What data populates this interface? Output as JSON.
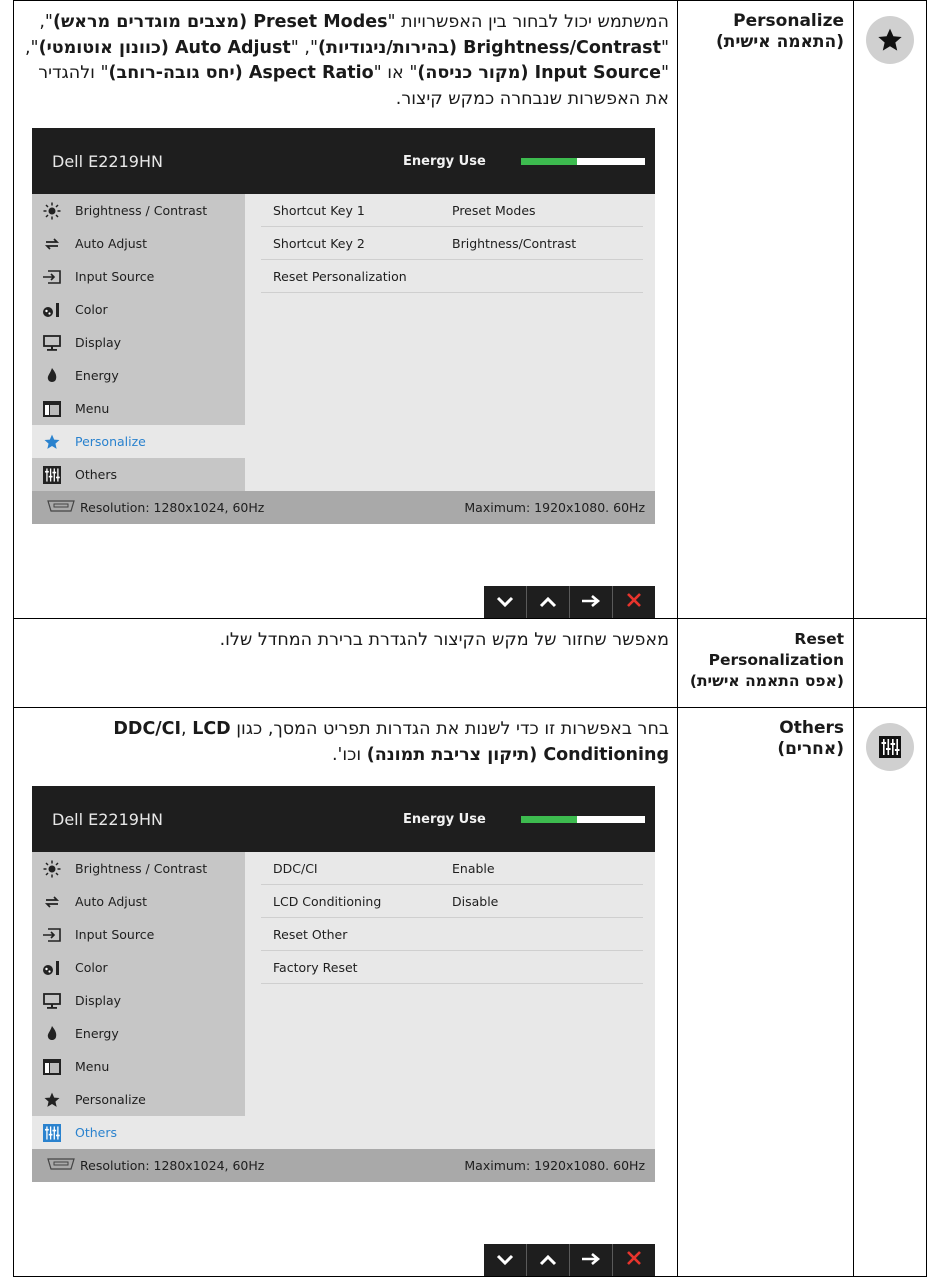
{
  "rows": [
    {
      "name_line1": "Personalize",
      "name_line2": "(התאמה אישית)",
      "icon": "star-icon",
      "desc_html_parts": {
        "p1": "המשתמש יכול לבחור בין האפשרויות \"",
        "b1": "Preset Modes (מצבים מוגדרים מראש)",
        "p2": "\", \"",
        "b2": "Brightness/Contrast (בהירות/ניגודיות)",
        "p3": "\", \"",
        "b3": "Auto Adjust (כוונון אוטומטי)",
        "p4": "\", \"",
        "b4": "Input Source (מקור כניסה)",
        "p5": "\" או \"",
        "b5": "Aspect Ratio (יחס גובה-רוחב)",
        "p6": "\" ולהגדיר את האפשרות שנבחרה כמקש קיצור."
      }
    },
    {
      "name": "Reset Personalization (אפס התאמה אישית)",
      "desc": "מאפשר שחזור של מקש הקיצור להגדרת ברירת המחדל שלו."
    },
    {
      "name_line1": "Others",
      "name_line2": "(אחרים)",
      "icon": "others-sliders-icon",
      "desc_parts": {
        "p1": "בחר באפשרות זו כדי לשנות את הגדרות תפריט המסך, כגון ",
        "b1": "DDC/CI",
        "p2": ", ",
        "b2": "LCD Conditioning (תיקון צריבת תמונה)",
        "p3": " וכו'."
      }
    }
  ],
  "osd": {
    "title": "Dell E2219HN",
    "energy_label": "Energy Use",
    "energy_level": 0.45,
    "menu": [
      "Brightness / Contrast",
      "Auto Adjust",
      "Input Source",
      "Color",
      "Display",
      "Energy",
      "Menu",
      "Personalize",
      "Others"
    ],
    "resolution": "Resolution: 1280x1024, 60Hz",
    "maximum": "Maximum: 1920x1080. 60Hz",
    "personalize_sub": [
      [
        "Shortcut Key 1",
        "Preset Modes"
      ],
      [
        "Shortcut Key 2",
        "Brightness/Contrast"
      ],
      [
        "Reset Personalization",
        ""
      ]
    ],
    "others_sub": [
      [
        "DDC/CI",
        "Enable"
      ],
      [
        "LCD Conditioning",
        "Disable"
      ],
      [
        "Reset Other",
        ""
      ],
      [
        "Factory Reset",
        ""
      ]
    ]
  },
  "colors": {
    "selected_text": "#2a82ce",
    "energy_fill": "#3dbb4f",
    "close_red": "#e8342d"
  }
}
